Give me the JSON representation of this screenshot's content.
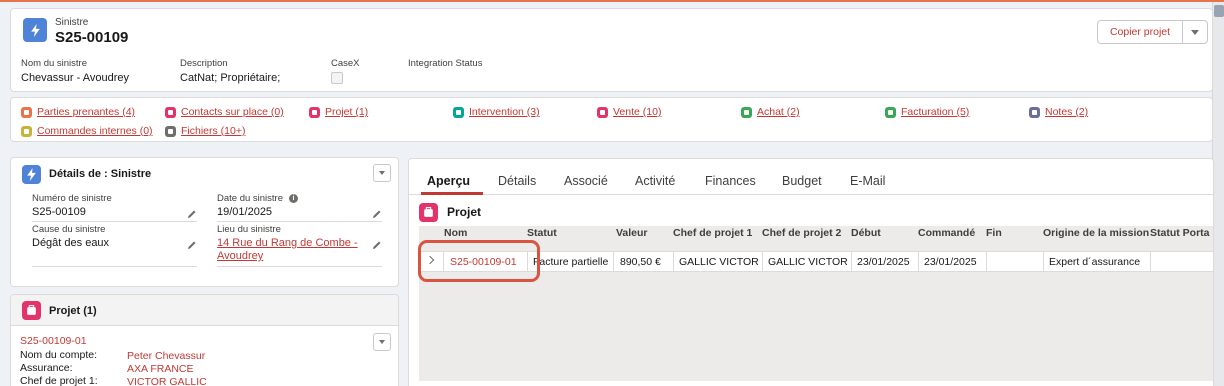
{
  "header": {
    "object_type": "Sinistre",
    "record_name": "S25-00109",
    "copy_button": "Copier projet",
    "fields": [
      {
        "label": "Nom du sinistre",
        "value": "Chevassur - Avoudrey"
      },
      {
        "label": "Description",
        "value": "CatNat; Propriétaire;"
      },
      {
        "label": "CaseX",
        "value": ""
      },
      {
        "label": "Integration Status",
        "value": ""
      }
    ]
  },
  "related_links": [
    {
      "label": "Parties prenantes (4)",
      "color": "#e8744b"
    },
    {
      "label": "Contacts sur place (0)",
      "color": "#e3336b"
    },
    {
      "label": "Projet (1)",
      "color": "#e3336b"
    },
    {
      "label": "Intervention (3)",
      "color": "#06a59a"
    },
    {
      "label": "Vente (10)",
      "color": "#e3336b"
    },
    {
      "label": "Achat (2)",
      "color": "#3ba755"
    },
    {
      "label": "Facturation (5)",
      "color": "#3ba755"
    },
    {
      "label": "Notes (2)",
      "color": "#6b6d9a"
    },
    {
      "label": "Commandes internes (0)",
      "color": "#c7b43a"
    },
    {
      "label": "Fichiers (10+)",
      "color": "#706e6b"
    }
  ],
  "details": {
    "title": "Détails de : Sinistre",
    "fields": [
      {
        "label": "Numéro de sinistre",
        "value": "S25-00109"
      },
      {
        "label": "Date du sinistre",
        "value": "19/01/2025"
      },
      {
        "label": "Cause du sinistre",
        "value": "Dégât des eaux"
      },
      {
        "label": "Lieu du sinistre",
        "value": "14 Rue du Rang de Combe - Avoudrey"
      }
    ]
  },
  "projet_card": {
    "title": "Projet (1)",
    "record": "S25-00109-01",
    "rows": [
      {
        "key": "Nom du compte:",
        "value": "Peter Chevassur"
      },
      {
        "key": "Assurance:",
        "value": "AXA FRANCE"
      },
      {
        "key": "Chef de projet 1:",
        "value": "VICTOR GALLIC"
      }
    ]
  },
  "main": {
    "tabs": [
      "Aperçu",
      "Détails",
      "Associé",
      "Activité",
      "Finances",
      "Budget",
      "E-Mail"
    ],
    "section_title": "Projet",
    "columns": [
      "Nom",
      "Statut",
      "Valeur",
      "Chef de projet 1",
      "Chef de projet 2",
      "Début",
      "Commandé",
      "Fin",
      "Origine de la mission",
      "Statut Porta"
    ],
    "row": [
      "S25-00109-01",
      "Facture partielle",
      "890,50 €",
      "GALLIC VICTOR",
      "GALLIC VICTOR",
      "23/01/2025",
      "23/01/2025",
      "",
      "Expert d´assurance",
      ""
    ]
  },
  "colors": {
    "accent": "#c23934",
    "object_icon": "#4f83d8",
    "highlight": "#d9553f"
  }
}
